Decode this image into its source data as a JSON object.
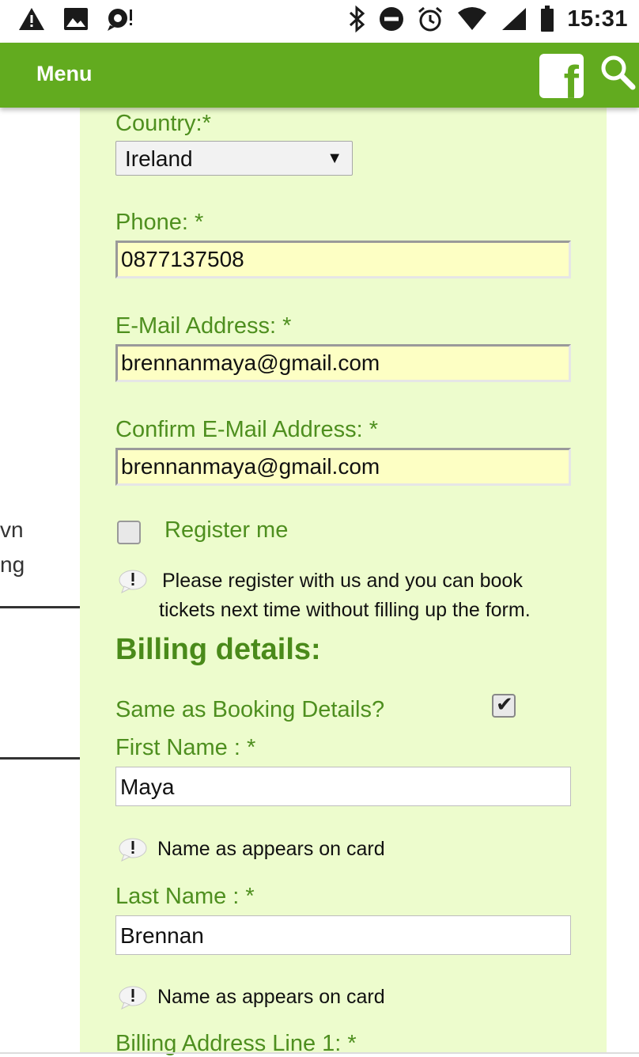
{
  "status_bar": {
    "time": "15:31",
    "left_icons": [
      "warning-icon",
      "image-icon",
      "notification-icon"
    ],
    "right_icons": [
      "bluetooth-icon",
      "do-not-disturb-icon",
      "alarm-icon",
      "wifi-icon",
      "signal-icon",
      "battery-icon"
    ]
  },
  "app_bar": {
    "menu_label": "Menu",
    "facebook_glyph": "f",
    "icons": [
      "facebook-icon",
      "search-icon"
    ],
    "accent_color": "#62ab1f"
  },
  "left_fragment": {
    "line1": "vn",
    "line2": "ng"
  },
  "form": {
    "country_label": "Country:*",
    "country_value": "Ireland",
    "phone_label": "Phone: *",
    "phone_value": "0877137508",
    "email_label": "E-Mail Address: *",
    "email_value": "brennanmaya@gmail.com",
    "confirm_email_label": "Confirm E-Mail Address: *",
    "confirm_email_value": "brennanmaya@gmail.com",
    "register_label": "Register me",
    "register_checked": false,
    "register_note_line1": "Please register with us and you can book",
    "register_note_line2": "tickets next time without filling up the form.",
    "billing_heading": "Billing details:",
    "same_as_booking_label": "Same as Booking Details?",
    "same_as_booking_checked": true,
    "first_name_label": "First Name : *",
    "first_name_value": "Maya",
    "first_name_note": "Name as appears on card",
    "last_name_label": "Last Name : *",
    "last_name_value": "Brennan",
    "last_name_note": "Name as appears on card",
    "billing_address_label": "Billing Address Line 1: *"
  },
  "colors": {
    "panel_bg": "#edfccd",
    "label_green": "#4e8f1f",
    "filled_input_bg": "#fdffc4"
  }
}
